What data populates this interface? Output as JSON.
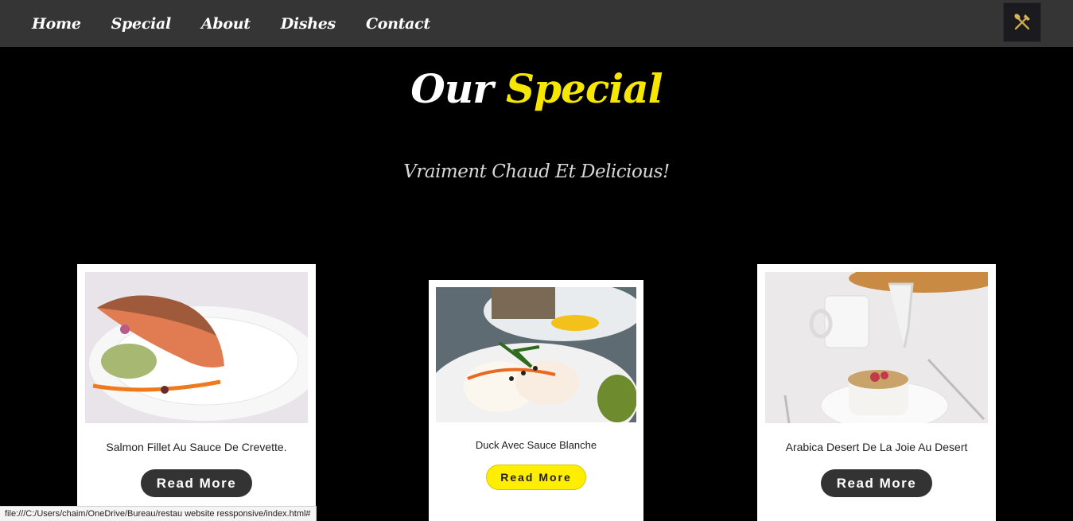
{
  "nav": {
    "links": [
      "Home",
      "Special",
      "About",
      "Dishes",
      "Contact"
    ],
    "logo_icon": "fork-knife-icon"
  },
  "section": {
    "title_part1": "Our",
    "title_part2": "Special",
    "subtitle": "Vraiment Chaud Et Delicious!"
  },
  "cards": [
    {
      "name": "Salmon Fillet Au Sauce De Crevette.",
      "button": "Read More",
      "image": "salmon-fillet-photo"
    },
    {
      "name": "Duck Avec Sauce Blanche",
      "button": "Read More",
      "image": "poached-egg-dish-photo"
    },
    {
      "name": "Arabica Desert De La Joie Au Desert",
      "button": "Read More",
      "image": "dessert-cup-photo"
    }
  ],
  "status_bar": {
    "url": "file:///C:/Users/chaim/OneDrive/Bureau/restau website ressponsive/index.html#"
  },
  "colors": {
    "accent": "#f6e600",
    "nav_bg": "#353535",
    "page_bg": "#000000",
    "button_dark": "#333333"
  }
}
